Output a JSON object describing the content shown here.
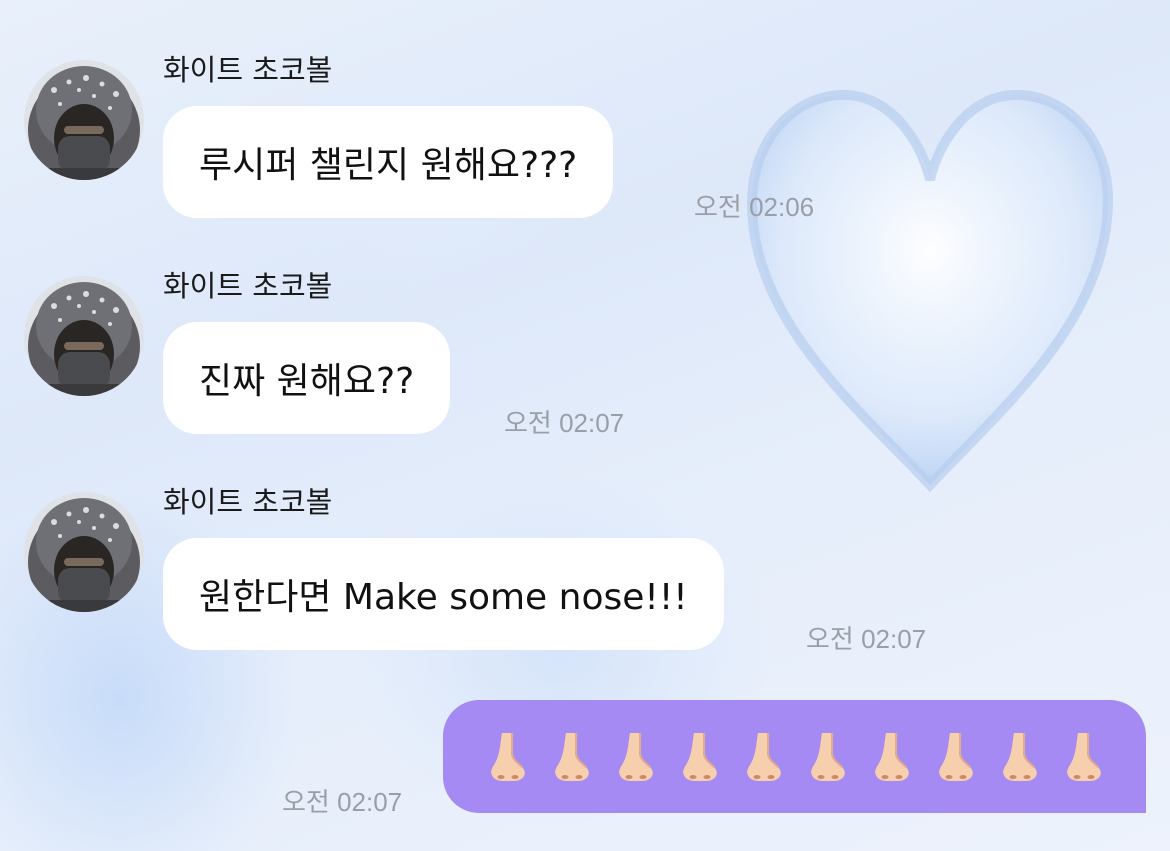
{
  "messages": [
    {
      "sender": "화이트 초코볼",
      "text": "루시퍼 챌린지 원해요???",
      "time": "오전 02:06"
    },
    {
      "sender": "화이트 초코볼",
      "text": "진짜 원해요??",
      "time": "오전 02:07"
    },
    {
      "sender": "화이트 초코볼",
      "text": "원한다면 Make some nose!!!",
      "time": "오전 02:07"
    }
  ],
  "sent": {
    "emoji": "nose-emoji",
    "emoji_count": 10,
    "time": "오전 02:07",
    "bubble_color": "#a58af4"
  },
  "colors": {
    "incoming_bubble": "#ffffff",
    "timestamp": "#9a9ea6"
  }
}
